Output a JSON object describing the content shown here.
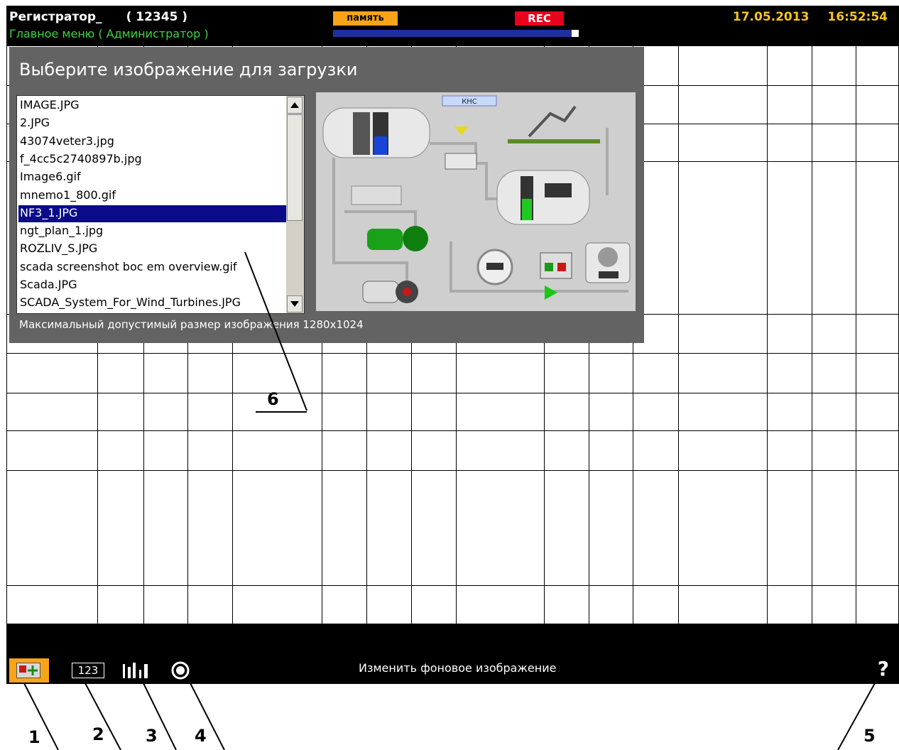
{
  "header": {
    "title": "Регистратор_",
    "device_id": "( 12345 )",
    "menu_path": "Главное меню ( Администратор )",
    "memory_label": "память",
    "memory_fill_fraction": 0.97,
    "rec_label": "REC",
    "date": "17.05.2013",
    "time": "16:52:54"
  },
  "dialog": {
    "title": "Выберите изображение для загрузки",
    "files": [
      "IMAGE.JPG",
      "2.JPG",
      "43074veter3.jpg",
      "f_4cc5c2740897b.jpg",
      "Image6.gif",
      "mnemo1_800.gif",
      "NF3_1.JPG",
      "ngt_plan_1.jpg",
      "ROZLIV_S.JPG",
      "scada screenshot boc em overview.gif",
      "Scada.JPG",
      "SCADA_System_For_Wind_Turbines.JPG"
    ],
    "selected_index": 6,
    "note": "Максимальный допустимый размер изображения 1280x1024",
    "preview": {
      "station_label": "КНС"
    }
  },
  "bottom": {
    "num_button": "123",
    "status_text": "Изменить фоновое изображение",
    "help": "?"
  },
  "callouts": [
    "1",
    "2",
    "3",
    "4",
    "5",
    "6"
  ],
  "colors": {
    "accent_orange": "#f7a41b",
    "rec_red": "#e8001c",
    "clock_yellow": "#f7c51e",
    "menu_green": "#3fd33f",
    "selection": "#0a0a8a"
  }
}
